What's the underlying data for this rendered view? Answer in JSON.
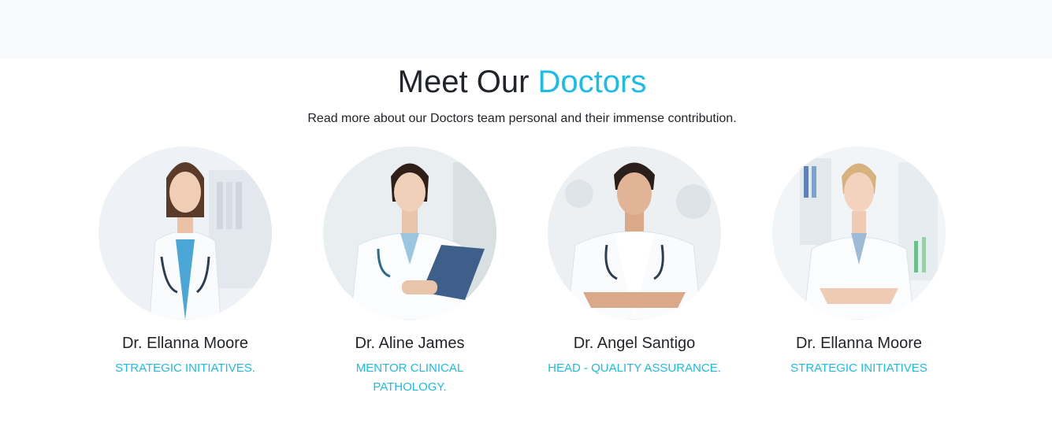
{
  "section": {
    "title_main": "Meet Our",
    "title_accent": "Doctors",
    "subtitle": "Read more about our Doctors team personal and their immense contribution."
  },
  "doctors": [
    {
      "name": "Dr. Ellanna Moore",
      "role": "STRATEGIC INITIATIVES.",
      "photo": "doctor-photo-female-blue-scrubs"
    },
    {
      "name": "Dr. Aline James",
      "role": "MENTOR CLINICAL PATHOLOGY.",
      "photo": "doctor-photo-female-clipboard"
    },
    {
      "name": "Dr. Angel Santigo",
      "role": "HEAD - QUALITY ASSURANCE.",
      "photo": "doctor-photo-male-arms-crossed"
    },
    {
      "name": "Dr. Ellanna Moore",
      "role": "STRATEGIC INITIATIVES",
      "photo": "doctor-photo-female-lab"
    }
  ],
  "colors": {
    "accent": "#1bbde8",
    "text": "#212529",
    "band": "#f8f9fa"
  }
}
